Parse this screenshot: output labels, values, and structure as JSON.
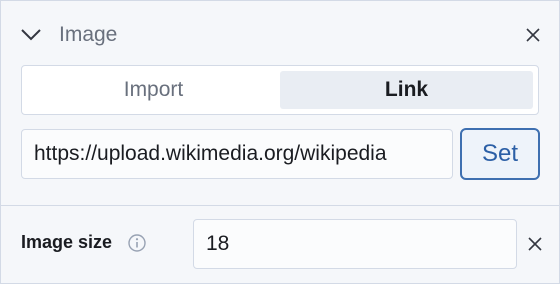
{
  "section": {
    "title": "Image",
    "collapse_icon": "chevron-down-icon",
    "close_icon": "close-icon"
  },
  "tabs": [
    {
      "label": "Import",
      "selected": false
    },
    {
      "label": "Link",
      "selected": true
    }
  ],
  "url_field": {
    "value": "https://upload.wikimedia.org/wikipedia"
  },
  "set_button": {
    "label": "Set"
  },
  "image_size": {
    "label": "Image size",
    "info_icon": "info-icon",
    "value": "18",
    "clear_icon": "close-icon"
  },
  "colors": {
    "accent": "#2c5fa6",
    "panel_bg": "#f5f7fa",
    "border": "#d3dae6",
    "selected_tab": "#e9edf3"
  }
}
